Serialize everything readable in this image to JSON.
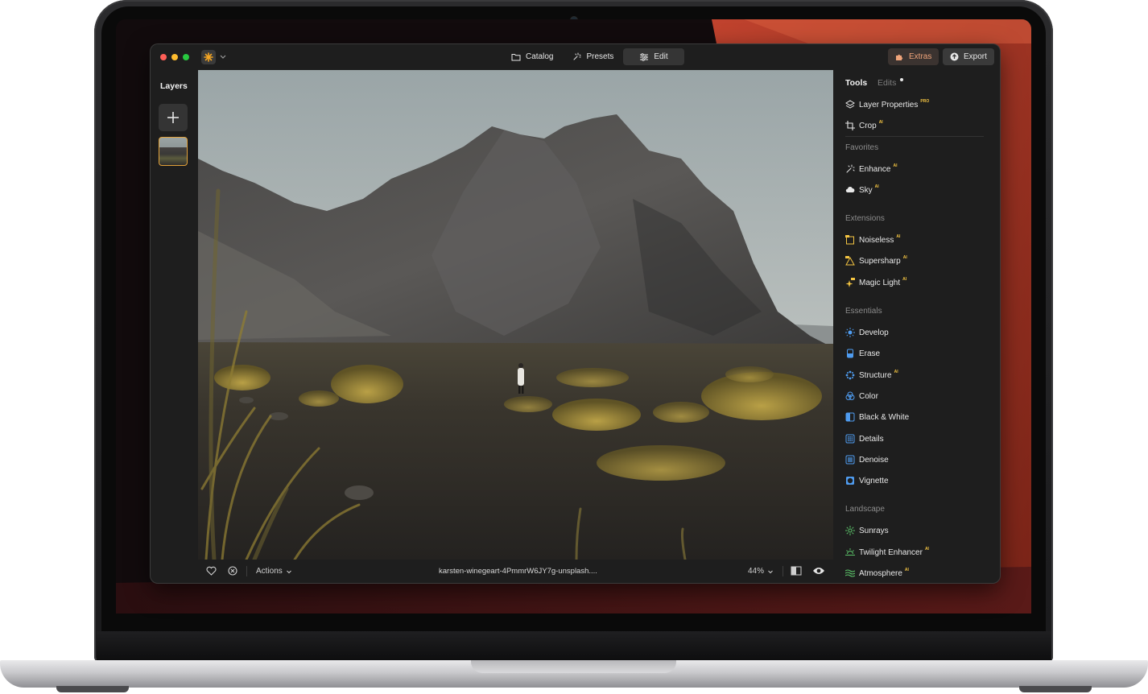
{
  "app": {
    "tabs": [
      {
        "label": "Catalog",
        "icon": "folder-icon"
      },
      {
        "label": "Presets",
        "icon": "sparkle-icon"
      },
      {
        "label": "Edit",
        "icon": "sliders-icon"
      }
    ],
    "active_tab": "Edit",
    "extras_label": "Extras",
    "export_label": "Export",
    "colors": {
      "accent": "#f0a47a",
      "window_bg": "#1e1e1e",
      "selection": "#e2a23a",
      "pro_badge": "#f5c542"
    }
  },
  "layers": {
    "title": "Layers",
    "add_icon": "plus-icon"
  },
  "tools_panel": {
    "tabs": {
      "tools": "Tools",
      "edits": "Edits"
    },
    "top": [
      {
        "label": "Layer Properties",
        "icon": "layers-icon",
        "badge": "PRO"
      },
      {
        "label": "Crop",
        "icon": "crop-icon",
        "badge": "AI"
      }
    ],
    "sections": [
      {
        "title": "Favorites",
        "items": [
          {
            "label": "Enhance",
            "icon": "enhance-icon",
            "badge": "AI"
          },
          {
            "label": "Sky",
            "icon": "cloud-icon",
            "badge": "AI"
          }
        ]
      },
      {
        "title": "Extensions",
        "items": [
          {
            "label": "Noiseless",
            "icon": "noiseless-icon",
            "badge": "AI"
          },
          {
            "label": "Supersharp",
            "icon": "supersharp-icon",
            "badge": "AI"
          },
          {
            "label": "Magic Light",
            "icon": "magic-light-icon",
            "badge": "AI"
          }
        ]
      },
      {
        "title": "Essentials",
        "items": [
          {
            "label": "Develop",
            "icon": "sun-icon",
            "badge": ""
          },
          {
            "label": "Erase",
            "icon": "eraser-icon",
            "badge": ""
          },
          {
            "label": "Structure",
            "icon": "structure-icon",
            "badge": "AI"
          },
          {
            "label": "Color",
            "icon": "color-icon",
            "badge": ""
          },
          {
            "label": "Black & White",
            "icon": "bw-icon",
            "badge": ""
          },
          {
            "label": "Details",
            "icon": "details-icon",
            "badge": ""
          },
          {
            "label": "Denoise",
            "icon": "denoise-icon",
            "badge": ""
          },
          {
            "label": "Vignette",
            "icon": "vignette-icon",
            "badge": ""
          }
        ]
      },
      {
        "title": "Landscape",
        "items": [
          {
            "label": "Sunrays",
            "icon": "sunrays-icon",
            "badge": ""
          },
          {
            "label": "Twilight Enhancer",
            "icon": "twilight-icon",
            "badge": "AI"
          },
          {
            "label": "Atmosphere",
            "icon": "atmosphere-icon",
            "badge": "AI"
          }
        ]
      }
    ]
  },
  "bottom_bar": {
    "actions_label": "Actions",
    "filename": "karsten-winegeart-4PmmrW6JY7g-unsplash....",
    "zoom": "44%"
  }
}
